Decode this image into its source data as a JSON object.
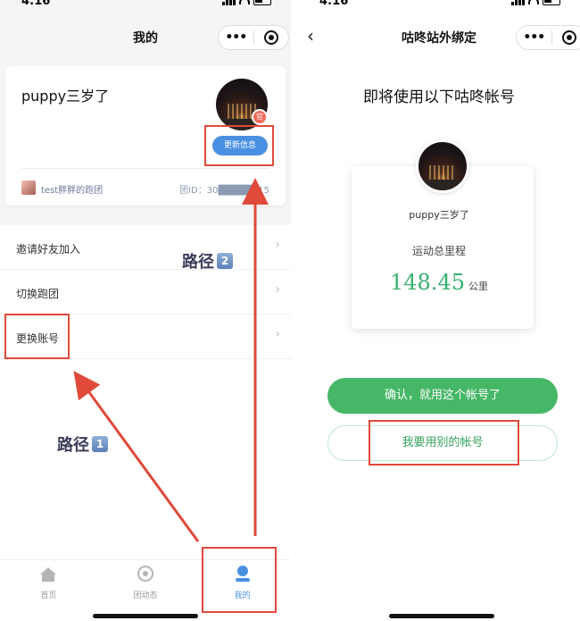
{
  "left": {
    "status": {
      "time": "4:16"
    },
    "nav": {
      "title": "我的",
      "more_label": "•••"
    },
    "profile": {
      "username": "puppy三岁了",
      "badge": "官",
      "update_button": "更新信息",
      "team_name": "test胖胖的跑团",
      "team_id": "团ID：30█████515"
    },
    "menu": [
      {
        "label": "邀请好友加入",
        "chevron": "›"
      },
      {
        "label": "切换跑团",
        "chevron": "›"
      },
      {
        "label": "更换账号",
        "chevron": "›"
      }
    ],
    "annotations": {
      "path1": {
        "text": "路径",
        "key": "1"
      },
      "path2": {
        "text": "路径",
        "key": "2"
      }
    },
    "tabbar": [
      {
        "label": "首页",
        "icon": "home-icon"
      },
      {
        "label": "团动态",
        "icon": "team-feed-icon"
      },
      {
        "label": "我的",
        "icon": "profile-icon",
        "active": true
      }
    ]
  },
  "right": {
    "status": {
      "time": "4:16"
    },
    "nav": {
      "title": "咕咚站外绑定",
      "back": "‹",
      "more_label": "•••"
    },
    "heading": "即将使用以下咕咚帐号",
    "account": {
      "name": "puppy三岁了",
      "distance_label": "运动总里程",
      "distance": "148.45",
      "unit": "公里"
    },
    "confirm_button": "确认，就用这个帐号了",
    "other_button": "我要用别的帐号"
  },
  "colors": {
    "accent_blue": "#4a90e2",
    "accent_green": "#46b766",
    "annotation_red": "#e04a3a"
  }
}
